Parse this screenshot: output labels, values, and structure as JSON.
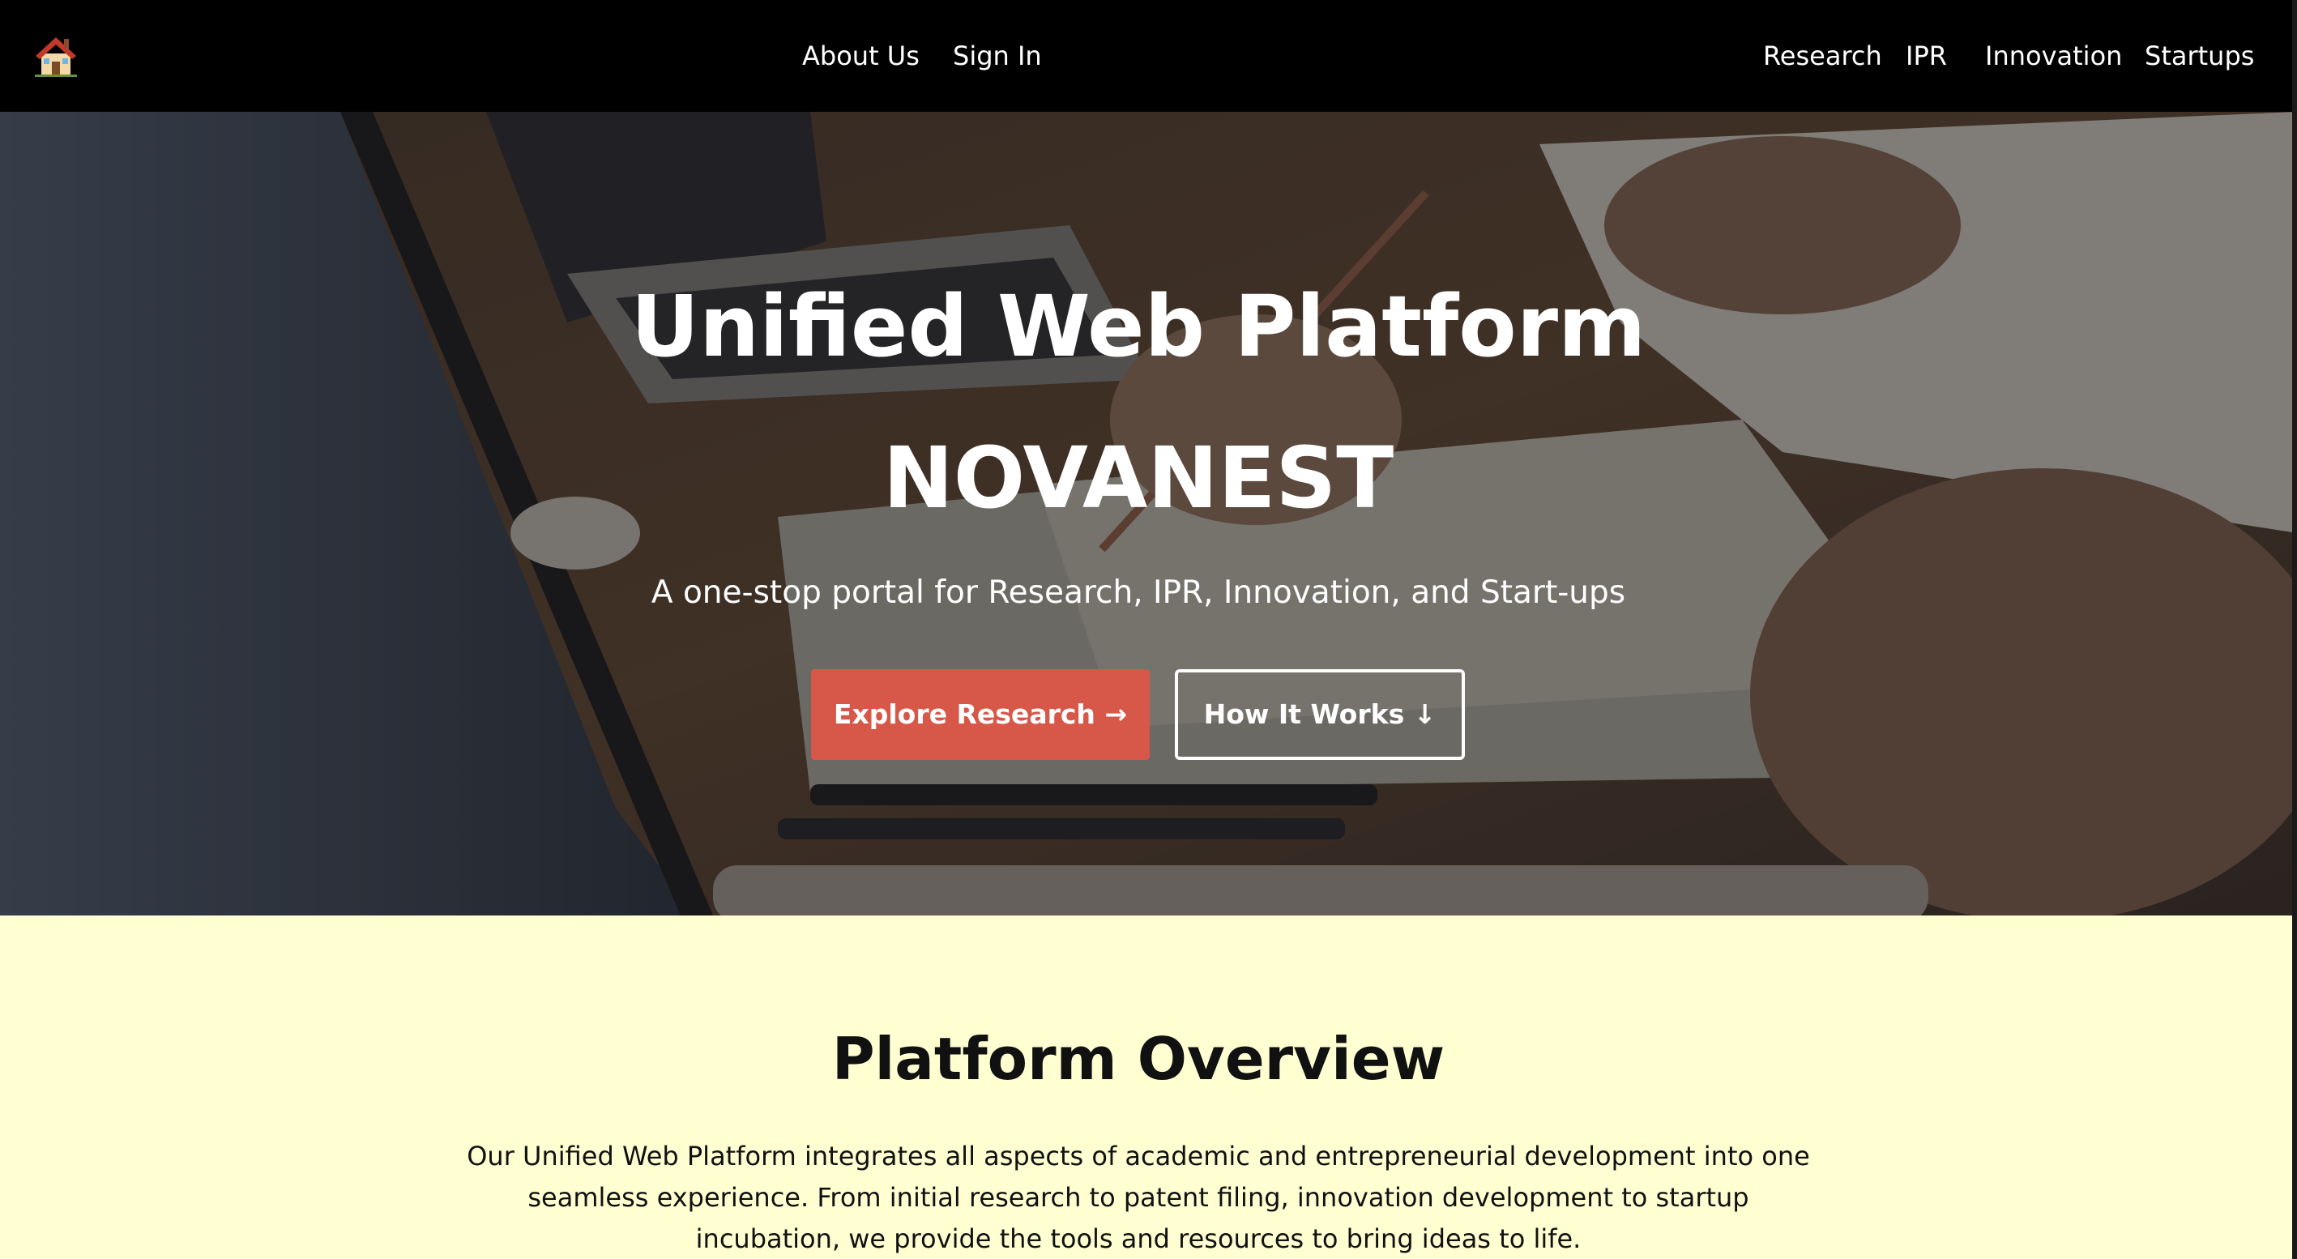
{
  "nav": {
    "home_icon": "house-icon",
    "about_label": "About Us",
    "signin_label": "Sign In",
    "research_label": "Research",
    "ipr_label": "IPR",
    "innovation_label": "Innovation",
    "startups_label": "Startups"
  },
  "hero": {
    "title": "Unified Web Platform",
    "brand": "NOVANEST",
    "subtitle": "A one-stop portal for Research, IPR, Innovation, and Start-ups",
    "primary_button": "Explore Research →",
    "secondary_button": "How It Works ↓"
  },
  "overview": {
    "title": "Platform Overview",
    "description": "Our Unified Web Platform integrates all aspects of academic and entrepreneurial development into one seamless experience. From initial research to patent filing, innovation development to startup incubation, we provide the tools and resources to bring ideas to life."
  },
  "colors": {
    "nav_background": "#000000",
    "accent": "#d75748",
    "section_background": "#ffffd2",
    "text_light": "#ffffff",
    "text_dark": "#111111"
  }
}
